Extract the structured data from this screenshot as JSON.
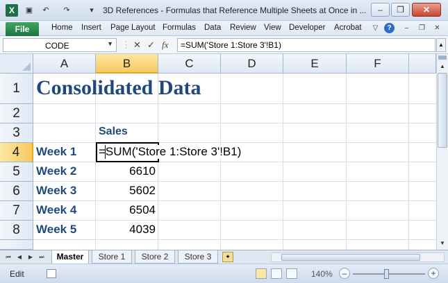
{
  "window": {
    "title": "3D References - Formulas that Reference Multiple Sheets at Once in ...",
    "minimize": "–",
    "restore": "❐",
    "close": "✕"
  },
  "qat": {
    "save": "💾",
    "undo": "↶",
    "redo": "↷",
    "customize": "▾"
  },
  "ribbon": {
    "file": "File",
    "tabs": [
      "Home",
      "Insert",
      "Page Layout",
      "Formulas",
      "Data",
      "Review",
      "View",
      "Developer",
      "Acrobat"
    ]
  },
  "formula_bar": {
    "name_box": "CODE",
    "cancel": "✕",
    "enter": "✓",
    "fx": "fx",
    "formula": "=SUM('Store 1:Store 3'!B1)"
  },
  "sheet": {
    "columns": [
      "A",
      "B",
      "C",
      "D",
      "E",
      "F"
    ],
    "rows": [
      "1",
      "2",
      "3",
      "4",
      "5",
      "6",
      "7",
      "8"
    ],
    "title": "Consolidated Data",
    "header": "Sales",
    "weeks": [
      {
        "label": "Week 1",
        "value": ""
      },
      {
        "label": "Week 2",
        "value": "6610"
      },
      {
        "label": "Week 3",
        "value": "5602"
      },
      {
        "label": "Week 4",
        "value": "6504"
      },
      {
        "label": "Week 5",
        "value": "4039"
      }
    ],
    "editing_text": "=SUM('Store 1:Store 3'!B1)"
  },
  "tabs": {
    "nav": [
      "⏮",
      "◀",
      "▶",
      "⏭"
    ],
    "sheets": [
      "Master",
      "Store 1",
      "Store 2",
      "Store 3"
    ],
    "active": "Master"
  },
  "status": {
    "mode": "Edit",
    "zoom": "140%",
    "zoom_value_percent": 140
  }
}
